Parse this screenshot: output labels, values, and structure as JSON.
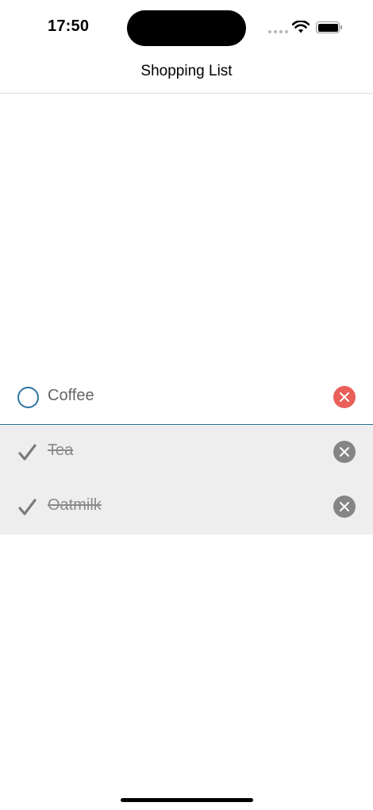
{
  "status_bar": {
    "time": "17:50"
  },
  "nav": {
    "title": "Shopping List"
  },
  "items": [
    {
      "label": "Coffee",
      "checked": false
    },
    {
      "label": "Tea",
      "checked": true
    },
    {
      "label": "Oatmilk",
      "checked": true
    }
  ],
  "colors": {
    "accent": "#2e74a2",
    "delete_active": "#ea5f5a",
    "delete_done": "#858585",
    "done_background": "#eeeeee"
  }
}
